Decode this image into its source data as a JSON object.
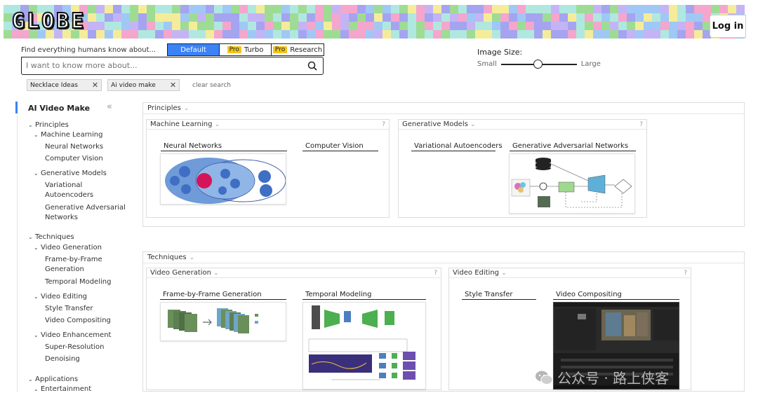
{
  "header": {
    "logo": "GLOBE",
    "login_label": "Log in",
    "palette": [
      "#a5a4f0",
      "#9edc94",
      "#f5a6cc",
      "#b0e8e0",
      "#f5ec9a",
      "#c4b4f5",
      "#a0c8f5"
    ]
  },
  "search": {
    "label": "Find everything humans know about...",
    "modes": [
      {
        "label": "Default",
        "active": true
      },
      {
        "label": "Turbo",
        "badge": "Pro"
      },
      {
        "label": "Research",
        "badge": "Pro"
      }
    ],
    "placeholder": "I want to know more about...",
    "chips": [
      "Necklace Ideas",
      "Ai video make"
    ],
    "clear_label": "clear search"
  },
  "image_size": {
    "label": "Image Size:",
    "small_label": "Small",
    "large_label": "Large",
    "level": 0.48
  },
  "sidebar": {
    "title": "AI Video Make",
    "items": [
      {
        "label": "Principles",
        "level": 0,
        "expanded": true
      },
      {
        "label": "Machine Learning",
        "level": 1,
        "expanded": true
      },
      {
        "label": "Neural Networks",
        "level": 2
      },
      {
        "label": "Computer Vision",
        "level": 2
      },
      {
        "label": "Generative Models",
        "level": 1,
        "expanded": true
      },
      {
        "label": "Variational Autoencoders",
        "level": 2
      },
      {
        "label": "Generative Adversarial Networks",
        "level": 2
      },
      {
        "label": "Techniques",
        "level": 0,
        "expanded": true
      },
      {
        "label": "Video Generation",
        "level": 1,
        "expanded": true
      },
      {
        "label": "Frame-by-Frame Generation",
        "level": 2
      },
      {
        "label": "Temporal Modeling",
        "level": 2
      },
      {
        "label": "Video Editing",
        "level": 1,
        "expanded": true
      },
      {
        "label": "Style Transfer",
        "level": 2
      },
      {
        "label": "Video Compositing",
        "level": 2
      },
      {
        "label": "Video Enhancement",
        "level": 1,
        "expanded": true
      },
      {
        "label": "Super-Resolution",
        "level": 2
      },
      {
        "label": "Denoising",
        "level": 2
      },
      {
        "label": "Applications",
        "level": 0,
        "expanded": true
      },
      {
        "label": "Entertainment",
        "level": 1,
        "expanded": true
      }
    ]
  },
  "main": {
    "principles": {
      "title": "Principles",
      "groups": [
        {
          "title": "Machine Learning",
          "help": "?",
          "cards": [
            "Neural Networks",
            "Computer Vision"
          ]
        },
        {
          "title": "Generative Models",
          "help": "?",
          "cards": [
            "Variational Autoencoders",
            "Generative Adversarial Networks"
          ]
        }
      ]
    },
    "techniques": {
      "title": "Techniques",
      "groups": [
        {
          "title": "Video Generation",
          "help": "?",
          "cards": [
            "Frame-by-Frame Generation",
            "Temporal Modeling"
          ]
        },
        {
          "title": "Video Editing",
          "help": "?",
          "cards": [
            "Style Transfer",
            "Video Compositing"
          ]
        }
      ]
    }
  },
  "watermark": "公众号 · 路上侠客"
}
